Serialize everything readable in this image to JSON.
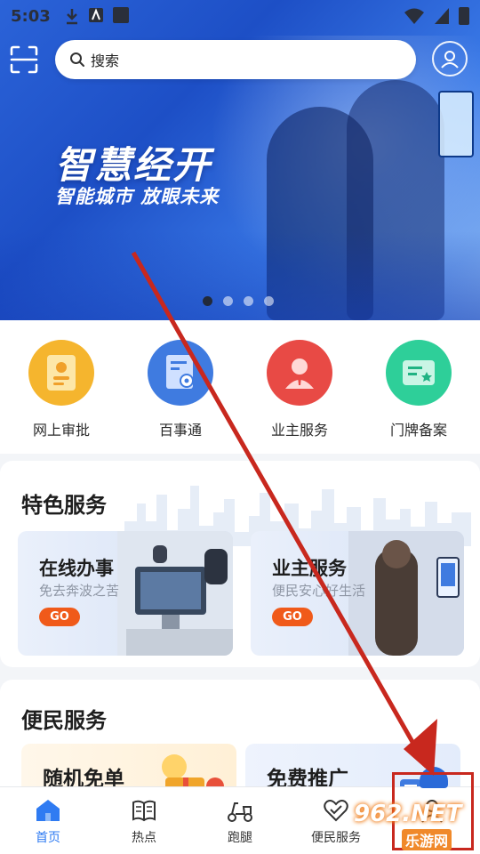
{
  "status_bar": {
    "time": "5:03"
  },
  "search": {
    "placeholder": "搜索"
  },
  "banner": {
    "title": "智慧经开",
    "subtitle": "智能城市 放眼未来",
    "slide_count": 4,
    "active_slide": 1
  },
  "quick_actions": [
    {
      "label": "网上审批",
      "icon": "document-approval-icon",
      "color": "#f5b52e"
    },
    {
      "label": "百事通",
      "icon": "info-document-icon",
      "color": "#3f7be0"
    },
    {
      "label": "业主服务",
      "icon": "owner-person-icon",
      "color": "#e84a45"
    },
    {
      "label": "门牌备案",
      "icon": "door-plate-icon",
      "color": "#2ecf99"
    }
  ],
  "featured_services": {
    "title": "特色服务",
    "cards": [
      {
        "title": "在线办事",
        "subtitle": "免去奔波之苦",
        "button": "GO"
      },
      {
        "title": "业主服务",
        "subtitle": "便民安心好生活",
        "button": "GO"
      }
    ]
  },
  "convenience_services": {
    "title": "便民服务",
    "cards": [
      {
        "title": "随机免单"
      },
      {
        "title": "免费推广"
      }
    ]
  },
  "bottom_nav": [
    {
      "label": "首页",
      "icon": "home-icon",
      "active": true
    },
    {
      "label": "热点",
      "icon": "book-icon",
      "active": false
    },
    {
      "label": "跑腿",
      "icon": "scooter-icon",
      "active": false
    },
    {
      "label": "便民服务",
      "icon": "heart-hand-icon",
      "active": false
    },
    {
      "label": "",
      "icon": "person-icon",
      "active": false
    }
  ],
  "watermark": {
    "brand": "962.NET",
    "site": "乐游网"
  },
  "colors": {
    "accent": "#2f7bf2",
    "go_button": "#f05a1a",
    "annotation": "#c8281e"
  }
}
